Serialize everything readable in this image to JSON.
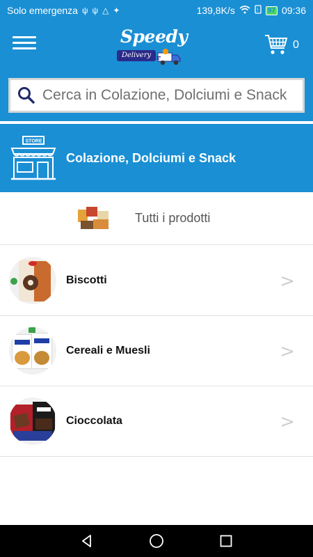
{
  "status_bar": {
    "carrier": "Solo emergenza",
    "speed": "139,8K/s",
    "battery": "97",
    "time": "09:36"
  },
  "header": {
    "logo_text": "Speedy",
    "logo_sub": "Delivery",
    "cart_count": "0"
  },
  "search": {
    "placeholder": "Cerca in Colazione, Dolciumi e Snack"
  },
  "category": {
    "title": "Colazione, Dolciumi e Snack",
    "store_sign": "STORE"
  },
  "all_products": {
    "label": "Tutti i prodotti"
  },
  "subcategories": [
    {
      "label": "Biscotti",
      "icon": "biscotti-thumbnail",
      "arrow": ">"
    },
    {
      "label": "Cereali e Muesli",
      "icon": "cereali-thumbnail",
      "arrow": ">"
    },
    {
      "label": "Cioccolata",
      "icon": "cioccolata-thumbnail",
      "arrow": ">"
    }
  ],
  "colors": {
    "primary": "#1a8fd4",
    "divider": "#e2e2e2",
    "arrow": "#cfcfcf"
  }
}
